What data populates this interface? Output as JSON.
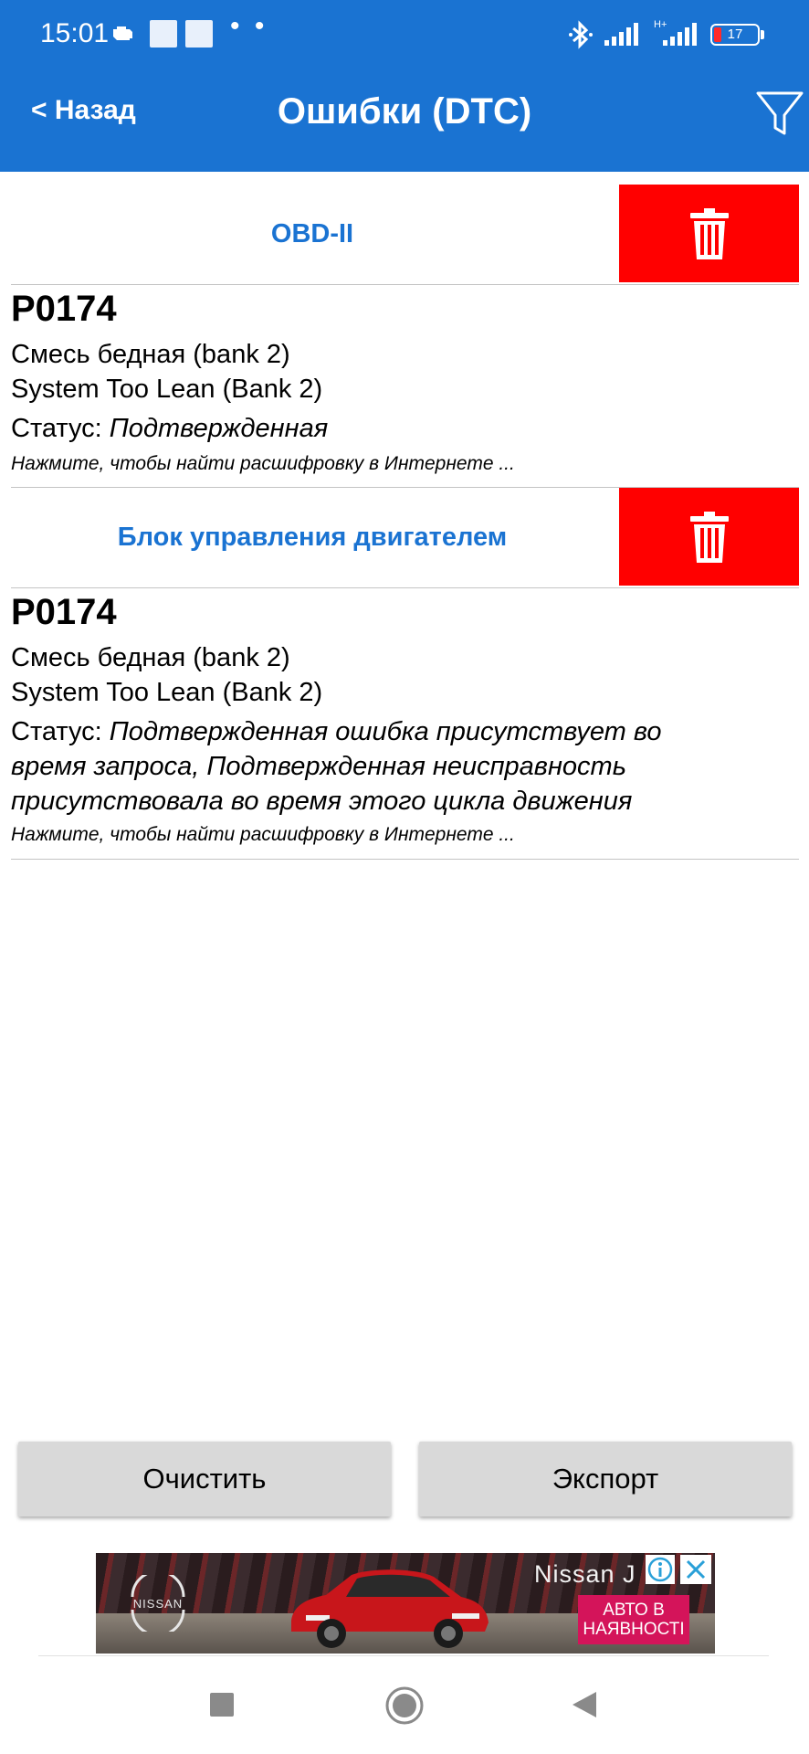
{
  "status_bar": {
    "time": "15:01",
    "network_label": "H+",
    "battery_level": "17",
    "dots": "• •"
  },
  "header": {
    "back_label": "< Назад",
    "title": "Ошибки (DTC)",
    "background_color": "#1a73d2"
  },
  "sections": [
    {
      "title": "OBD-II",
      "entries": [
        {
          "code": "P0174",
          "description_ru": "Смесь бедная (bank 2)",
          "description_en": "System Too Lean (Bank 2)",
          "status_label": "Статус: ",
          "status_value": "Подтвержденная",
          "hint": "Нажмите, чтобы найти расшифровку в Интернете ..."
        }
      ]
    },
    {
      "title": "Блок управления двигателем",
      "entries": [
        {
          "code": "P0174",
          "description_ru": "Смесь бедная (bank 2)",
          "description_en": "System Too Lean (Bank 2)",
          "status_label": "Статус: ",
          "status_value": "Подтвержденная ошибка присутствует во время запроса, Подтвержденная неисправность присутствовала во время этого цикла движения",
          "hint": "Нажмите, чтобы найти расшифровку в Интернете ..."
        }
      ]
    }
  ],
  "actions": {
    "clear_label": "Очистить",
    "export_label": "Экспорт"
  },
  "ad": {
    "brand_text": "Nissan J",
    "logo_text": "NISSAN",
    "cta_text": "АВТО В НАЯВНОСТІ",
    "cta_color": "#d4145a"
  },
  "colors": {
    "delete": "#ff0000",
    "section_title": "#1a73d2"
  }
}
